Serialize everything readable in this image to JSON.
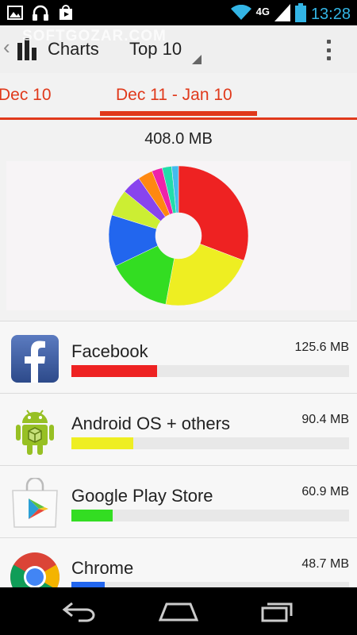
{
  "status_bar": {
    "network": "4G",
    "time": "13:28",
    "icons": [
      "gallery-icon",
      "headphones-icon",
      "play-store-notification-icon",
      "wifi-icon",
      "signal-icon",
      "battery-icon"
    ]
  },
  "action_bar": {
    "title": "Charts",
    "spinner_value": "Top 10",
    "watermark": "SOFTGOZAR.COM"
  },
  "tabs": {
    "previous": "Dec 10",
    "current": "Dec 11 - Jan 10",
    "accent": "#e0391b"
  },
  "summary": {
    "total": "408.0 MB"
  },
  "chart_data": {
    "type": "pie",
    "title": "408.0 MB",
    "slices": [
      {
        "value": 125.6,
        "color": "#ee2222"
      },
      {
        "value": 90.4,
        "color": "#eeee22"
      },
      {
        "value": 60.9,
        "color": "#33dd22"
      },
      {
        "value": 48.7,
        "color": "#2266ee"
      },
      {
        "value": 25.0,
        "color": "#ccee33"
      },
      {
        "value": 18.0,
        "color": "#8844ee"
      },
      {
        "value": 14.0,
        "color": "#ff8811"
      },
      {
        "value": 10.0,
        "color": "#ee22aa"
      },
      {
        "value": 9.0,
        "color": "#22ddaa"
      },
      {
        "value": 6.4,
        "color": "#44bbee"
      }
    ]
  },
  "apps": [
    {
      "name": "Facebook",
      "size": "125.6 MB",
      "size_mb": 125.6,
      "color": "#ee2222",
      "icon": "facebook-icon"
    },
    {
      "name": "Android OS + others",
      "size": "90.4 MB",
      "size_mb": 90.4,
      "color": "#eeee22",
      "icon": "android-icon"
    },
    {
      "name": "Google Play Store",
      "size": "60.9 MB",
      "size_mb": 60.9,
      "color": "#33dd22",
      "icon": "play-store-icon"
    },
    {
      "name": "Chrome",
      "size": "48.7 MB",
      "size_mb": 48.7,
      "color": "#2266ee",
      "icon": "chrome-icon"
    }
  ],
  "nav_bar": {
    "buttons": [
      "back-icon",
      "home-icon",
      "recents-icon"
    ]
  }
}
